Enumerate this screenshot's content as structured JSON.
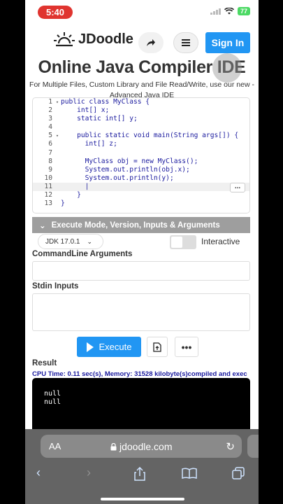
{
  "status": {
    "time": "5:40",
    "battery": "77"
  },
  "header": {
    "logo": "JDoodle",
    "signin": "Sign In"
  },
  "page": {
    "title": "Online Java Compiler IDE",
    "subtitle_pre": "For Multiple Files, Custom Library and File Read/Write, use our new - ",
    "subtitle_link": "Advanced Java IDE"
  },
  "editor": {
    "lines": [
      {
        "n": "1",
        "fold": "▾",
        "code": "public class MyClass {"
      },
      {
        "n": "2",
        "fold": "",
        "code": "    int[] x;"
      },
      {
        "n": "3",
        "fold": "",
        "code": "    static int[] y;"
      },
      {
        "n": "4",
        "fold": "",
        "code": ""
      },
      {
        "n": "5",
        "fold": "▾",
        "code": "    public static void main(String args[]) {"
      },
      {
        "n": "6",
        "fold": "",
        "code": "      int[] z;"
      },
      {
        "n": "7",
        "fold": "",
        "code": ""
      },
      {
        "n": "8",
        "fold": "",
        "code": "      MyClass obj = new MyClass();"
      },
      {
        "n": "9",
        "fold": "",
        "code": "      System.out.println(obj.x);"
      },
      {
        "n": "10",
        "fold": "",
        "code": "      System.out.println(y);"
      },
      {
        "n": "11",
        "fold": "",
        "code": "      |"
      },
      {
        "n": "12",
        "fold": "",
        "code": "    }"
      },
      {
        "n": "13",
        "fold": "",
        "code": "}"
      }
    ],
    "active_line": 11,
    "more": "..."
  },
  "execute_panel": {
    "header": "Execute Mode, Version, Inputs & Arguments",
    "jdk": "JDK 17.0.1",
    "interactive_label": "Interactive",
    "cmd_label": "CommandLine Arguments",
    "stdin_label": "Stdin Inputs",
    "execute_label": "Execute",
    "more": "•••"
  },
  "result": {
    "label": "Result",
    "cpu": "CPU Time: 0.11 sec(s), Memory: 31528 kilobyte(s)compiled and exec",
    "output": [
      "null",
      "null"
    ]
  },
  "safari": {
    "aa": "AA",
    "url": "jdoodle.com"
  }
}
